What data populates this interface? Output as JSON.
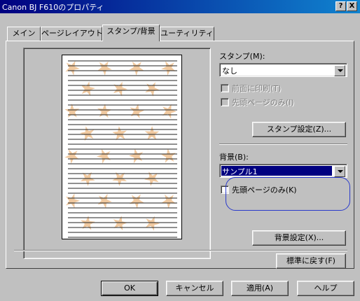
{
  "window": {
    "title": "Canon BJ F610のプロパティ",
    "help_label": "?",
    "close_label": "X"
  },
  "tabs": [
    {
      "label": "メイン"
    },
    {
      "label": "ページレイアウト"
    },
    {
      "label": "スタンプ/背景"
    },
    {
      "label": "ユーティリティ"
    }
  ],
  "stamp": {
    "label": "スタンプ(M):",
    "value": "なし",
    "front_print_label": "前面に印刷(T)",
    "first_page_only_label": "先頭ページのみ(I)",
    "settings_button": "スタンプ設定(Z)..."
  },
  "background": {
    "label": "背景(B):",
    "value": "サンプル1",
    "first_page_only_label": "先頭ページのみ(K)",
    "settings_button": "背景設定(X)..."
  },
  "defaults_button": "標準に戻す(F)",
  "footer": {
    "ok": "OK",
    "cancel": "キャンセル",
    "apply": "適用(A)",
    "help": "ヘルプ"
  },
  "colors": {
    "highlight": "#000080",
    "annotation": "#2a3acb",
    "star": "#f0c9a0"
  }
}
